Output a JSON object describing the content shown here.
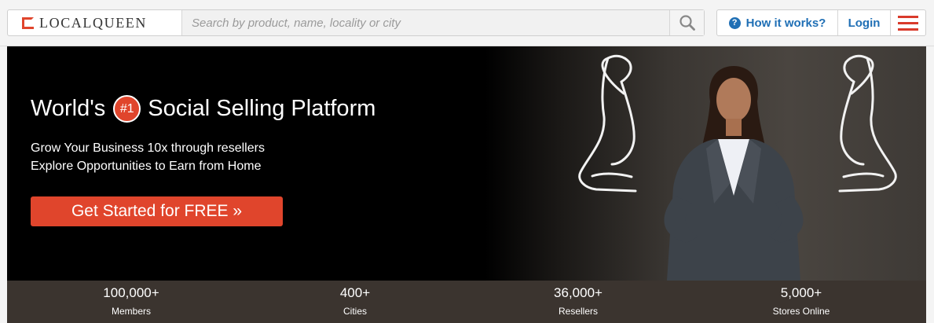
{
  "header": {
    "logo_text": "LOCALQUEEN",
    "search_placeholder": "Search by product, name, locality or city",
    "how_it_works_label": "How it works?",
    "login_label": "Login",
    "icons": [
      "search-icon",
      "help-circle-icon",
      "hamburger-menu-icon"
    ]
  },
  "hero": {
    "headline_before": "World's",
    "badge": "#1",
    "headline_after": "Social Selling Platform",
    "sub_line_1": "Grow Your Business 10x through resellers",
    "sub_line_2": "Explore Opportunities to Earn from Home",
    "cta_label": "Get Started for FREE »"
  },
  "stats": [
    {
      "value": "100,000+",
      "label": "Members"
    },
    {
      "value": "400+",
      "label": "Cities"
    },
    {
      "value": "36,000+",
      "label": "Resellers"
    },
    {
      "value": "5,000+",
      "label": "Stores Online"
    }
  ],
  "colors": {
    "accent_red": "#e0452c",
    "link_blue": "#1f6fb5",
    "stats_bar": "#3b342f"
  }
}
